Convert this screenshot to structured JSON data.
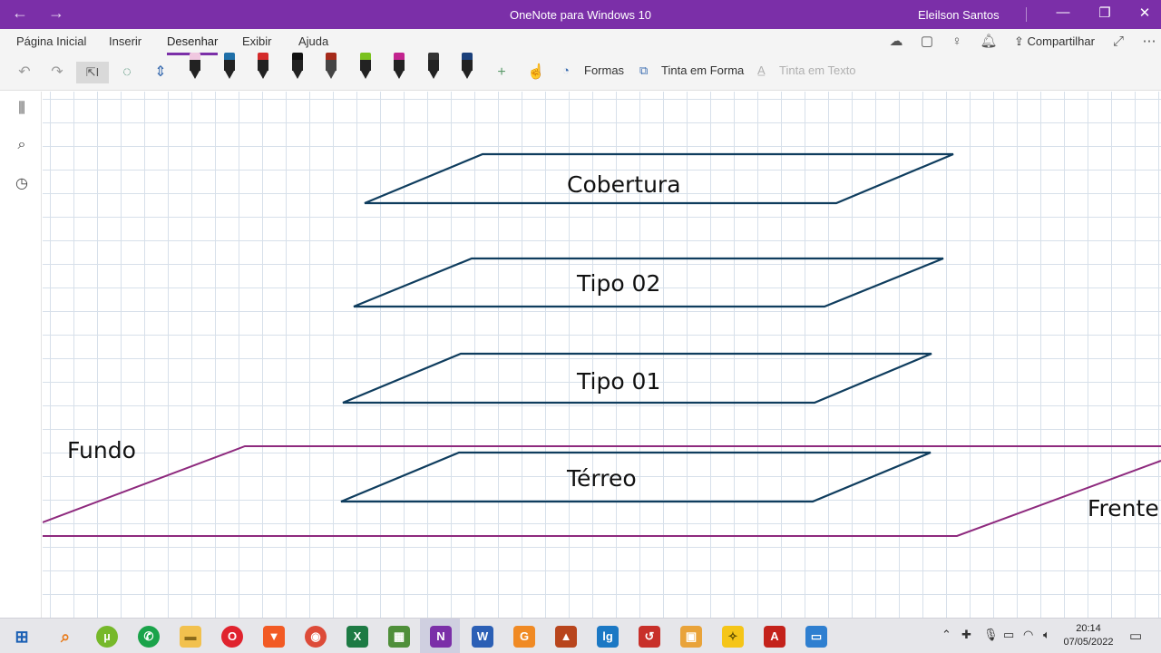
{
  "titlebar": {
    "title": "OneNote para Windows 10",
    "user": "Eleilson Santos",
    "back_icon": "←",
    "forward_icon": "→",
    "minimize_icon": "—",
    "maximize_icon": "❐",
    "close_icon": "✕"
  },
  "ribbon": {
    "tabs": [
      "Página Inicial",
      "Inserir",
      "Desenhar",
      "Exibir",
      "Ajuda"
    ],
    "active_tab": "Desenhar",
    "share_label": "Compartilhar",
    "formas_label": "Formas",
    "tinta_forma_label": "Tinta em Forma",
    "tinta_texto_label": "Tinta em Texto",
    "pens": [
      {
        "name": "pen-pink",
        "cap": "#f0c8e0",
        "body": "#222"
      },
      {
        "name": "pen-blue",
        "cap": "#1f6fa8",
        "body": "#222"
      },
      {
        "name": "pen-red",
        "cap": "#d42a2a",
        "body": "#222"
      },
      {
        "name": "pen-black",
        "cap": "#111111",
        "body": "#222"
      },
      {
        "name": "highlighter-darkred",
        "cap": "#a52a1a",
        "body": "#444"
      },
      {
        "name": "pen-green",
        "cap": "#7ac21e",
        "body": "#222"
      },
      {
        "name": "pen-magenta",
        "cap": "#c2248f",
        "body": "#222"
      },
      {
        "name": "pen-galaxy",
        "cap": "#333333",
        "body": "#222"
      },
      {
        "name": "pen-navy",
        "cap": "#1a3f7a",
        "body": "#222"
      }
    ]
  },
  "canvas": {
    "labels": {
      "cobertura": "Cobertura",
      "tipo02": "Tipo 02",
      "tipo01": "Tipo 01",
      "terreo": "Térreo",
      "fundo": "Fundo",
      "frente": "Frente"
    },
    "colors": {
      "floor_outline": "#0f3d5e",
      "ground_outline": "#8e2a7e"
    }
  },
  "taskbar": {
    "time": "20:14",
    "date": "07/05/2022"
  }
}
